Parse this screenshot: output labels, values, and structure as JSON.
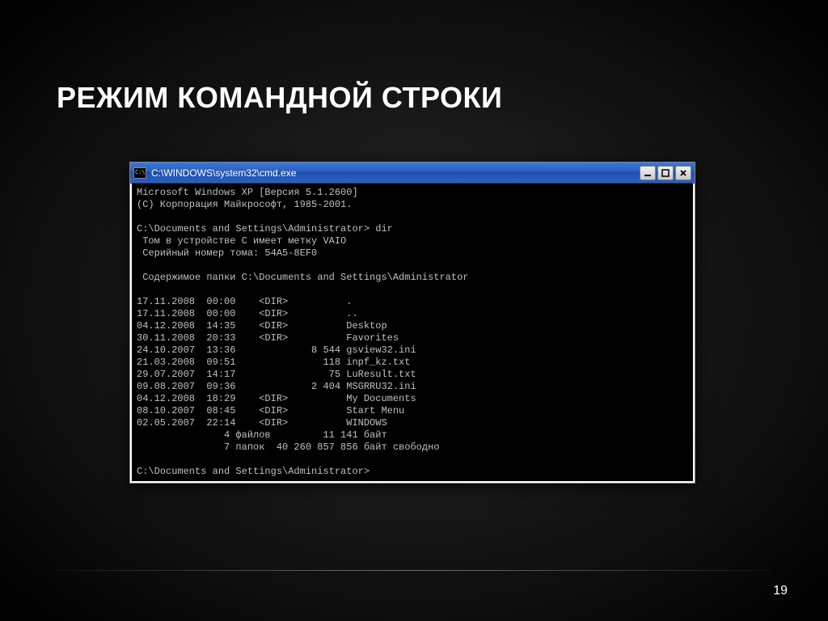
{
  "slide": {
    "title": "РЕЖИМ КОМАНДНОЙ СТРОКИ",
    "number": "19"
  },
  "window": {
    "title": "C:\\WINDOWS\\system32\\cmd.exe"
  },
  "console": {
    "header1": "Microsoft Windows XP [Версия 5.1.2600]",
    "header2": "(С) Корпорация Майкрософт, 1985-2001.",
    "prompt1": "C:\\Documents and Settings\\Administrator> dir",
    "vol1": " Том в устройстве C имеет метку VAIO",
    "vol2": " Серийный номер тома: 54A5-8EF0",
    "content": " Содержимое папки C:\\Documents and Settings\\Administrator",
    "rows": [
      "17.11.2008  00:00    <DIR>          .",
      "17.11.2008  00:00    <DIR>          ..",
      "04.12.2008  14:35    <DIR>          Desktop",
      "30.11.2008  20:33    <DIR>          Favorites",
      "24.10.2007  13:36             8 544 gsview32.ini",
      "21.03.2008  09:51               118 inpf_kz.txt",
      "29.07.2007  14:17                75 LuResult.txt",
      "09.08.2007  09:36             2 404 MSGRRU32.ini",
      "04.12.2008  18:29    <DIR>          My Documents",
      "08.10.2007  08:45    <DIR>          Start Menu",
      "02.05.2007  22:14    <DIR>          WINDOWS"
    ],
    "summary1": "               4 файлов         11 141 байт",
    "summary2": "               7 папок  40 260 857 856 байт свободно",
    "prompt2": "C:\\Documents and Settings\\Administrator>"
  }
}
